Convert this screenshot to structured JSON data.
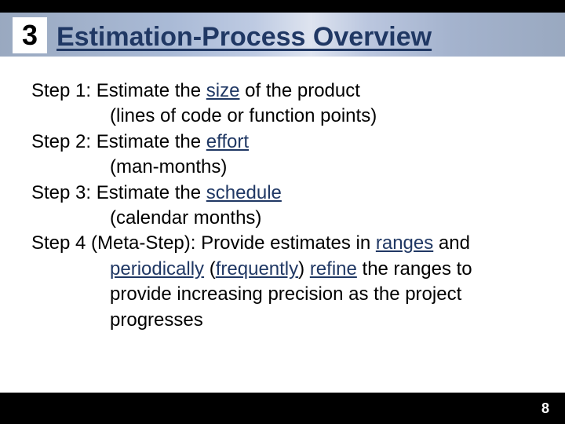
{
  "chapter": "3",
  "title": "Estimation-Process Overview",
  "steps": {
    "s1": {
      "lead": "Step 1: Estimate the ",
      "kw": "size",
      "tail": " of the product",
      "sub": "(lines of code or function points)"
    },
    "s2": {
      "lead": "Step 2: Estimate the ",
      "kw": "effort",
      "sub": "(man-months)"
    },
    "s3": {
      "lead": "Step 3: Estimate the ",
      "kw": "schedule",
      "sub": "(calendar months)"
    },
    "s4": {
      "lead": "Step 4 (Meta-Step): Provide estimates in ",
      "kw1": "ranges",
      "mid1": " and ",
      "kw2": "periodically",
      "mid2": " (",
      "kw3": "frequently",
      "mid3": ") ",
      "kw4": "refine",
      "tail": " the ranges to provide increasing precision as the project progresses"
    }
  },
  "page_number": "8"
}
